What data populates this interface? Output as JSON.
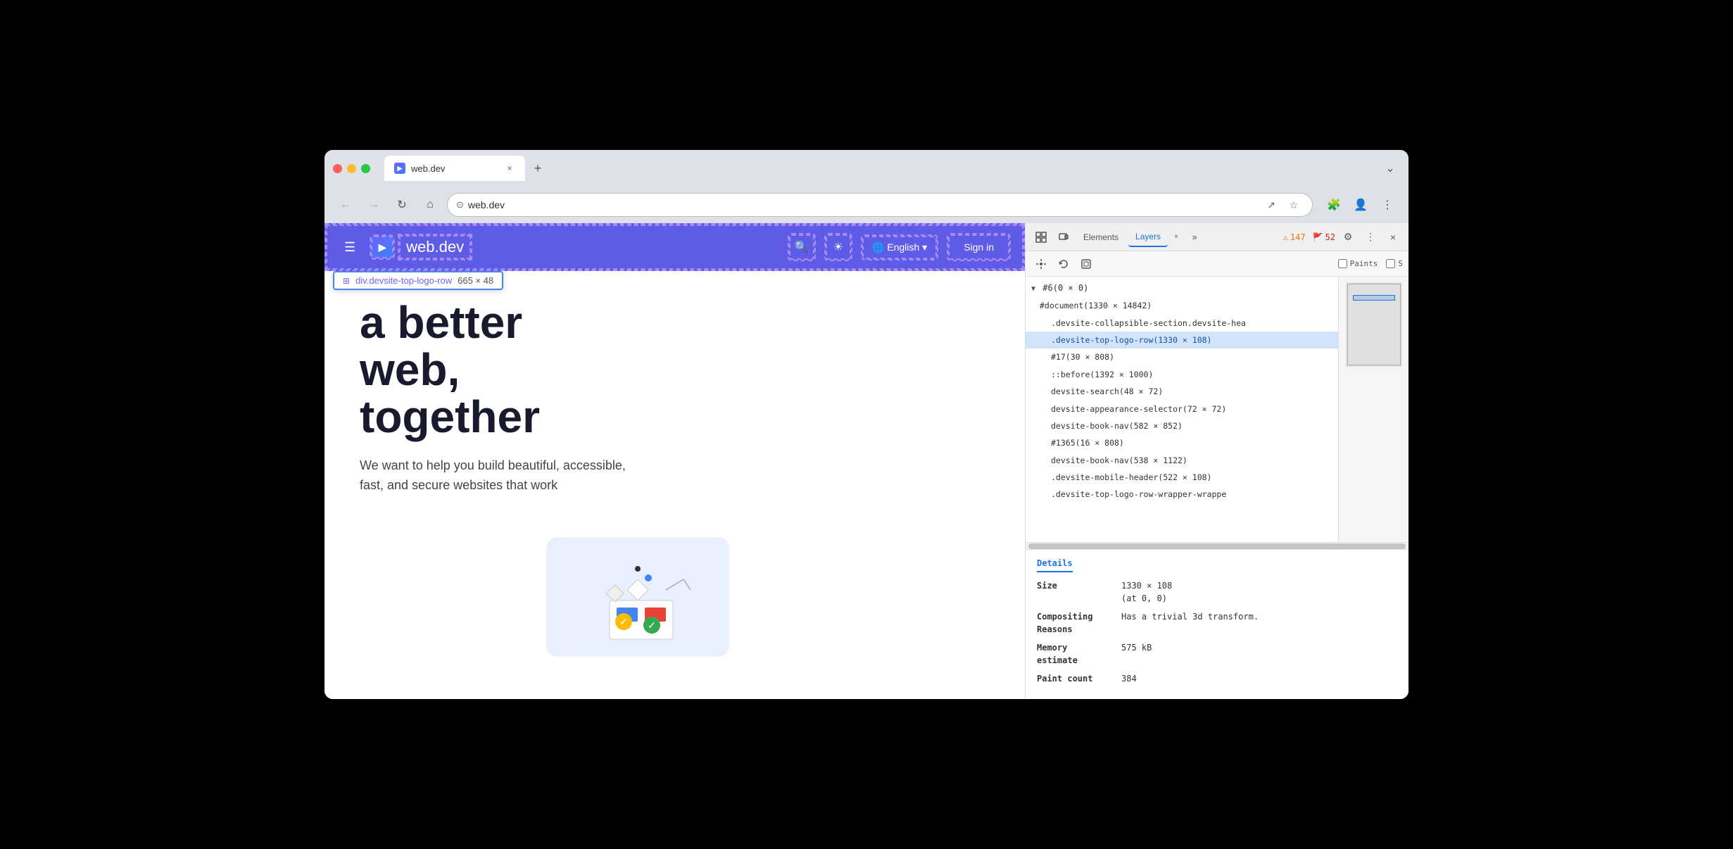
{
  "browser": {
    "tab_title": "web.dev",
    "tab_favicon": "▶",
    "url": "web.dev",
    "close_label": "×",
    "new_tab_label": "+",
    "dropdown_label": "⌄"
  },
  "nav": {
    "back_label": "←",
    "forward_label": "→",
    "reload_label": "↻",
    "home_label": "⌂",
    "url_icon": "⊙",
    "share_label": "↗",
    "bookmark_label": "☆",
    "extensions_label": "🧩",
    "profile_label": "👤",
    "more_label": "⋮"
  },
  "site": {
    "menu_icon": "☰",
    "logo_icon": "▶",
    "logo_text": "web.dev",
    "search_icon": "🔍",
    "theme_icon": "☀",
    "globe_icon": "🌐",
    "lang_label": "English",
    "lang_arrow": "▾",
    "signin_label": "Sign in"
  },
  "element_tooltip": {
    "icon": "⊞",
    "name": "div.devsite-top-logo-row",
    "size": "665 × 48"
  },
  "hero": {
    "heading_line1": "a better",
    "heading_line2": "web,",
    "heading_line3": "together",
    "subtext": "We want to help you build beautiful, accessible, fast, and secure websites that work"
  },
  "devtools": {
    "inspect_icon": "⊹",
    "device_icon": "⬚",
    "elements_tab": "Elements",
    "layers_tab": "Layers",
    "layers_tab_close": "×",
    "more_tabs_label": "»",
    "warning_count": "147",
    "error_count": "52",
    "settings_icon": "⚙",
    "more_icon": "⋮",
    "close_icon": "×",
    "warning_icon": "⚠",
    "error_icon": "🚩"
  },
  "layers_toolbar": {
    "pan_icon": "✥",
    "rotate_icon": "↺",
    "reset_icon": "⊡",
    "paints_label": "Paints",
    "slow_label": "S"
  },
  "layers_tree": {
    "items": [
      {
        "label": "#6(0 × 0)",
        "indent": 0,
        "selected": false,
        "arrow": "▼"
      },
      {
        "label": "#document(1330 × 14842)",
        "indent": 1,
        "selected": false,
        "arrow": ""
      },
      {
        "label": ".devsite-collapsible-section.devsite-hea",
        "indent": 2,
        "selected": false,
        "arrow": ""
      },
      {
        "label": ".devsite-top-logo-row(1330 × 108)",
        "indent": 2,
        "selected": true,
        "arrow": ""
      },
      {
        "label": "#17(30 × 808)",
        "indent": 2,
        "selected": false,
        "arrow": ""
      },
      {
        "label": "::before(1392 × 1000)",
        "indent": 2,
        "selected": false,
        "arrow": ""
      },
      {
        "label": "devsite-search(48 × 72)",
        "indent": 2,
        "selected": false,
        "arrow": ""
      },
      {
        "label": "devsite-appearance-selector(72 × 72)",
        "indent": 2,
        "selected": false,
        "arrow": ""
      },
      {
        "label": "devsite-book-nav(582 × 852)",
        "indent": 2,
        "selected": false,
        "arrow": ""
      },
      {
        "label": "#1365(16 × 808)",
        "indent": 2,
        "selected": false,
        "arrow": ""
      },
      {
        "label": "devsite-book-nav(538 × 1122)",
        "indent": 2,
        "selected": false,
        "arrow": ""
      },
      {
        "label": ".devsite-mobile-header(522 × 108)",
        "indent": 2,
        "selected": false,
        "arrow": ""
      },
      {
        "label": ".devsite-top-logo-row-wrapper-wrappe",
        "indent": 2,
        "selected": false,
        "arrow": ""
      }
    ]
  },
  "details": {
    "header": "Details",
    "size_label": "Size",
    "size_value": "1330 × 108",
    "size_at": "(at 0, 0)",
    "compositing_label": "Compositing\nReasons",
    "compositing_value": "Has a trivial 3d transform.",
    "memory_label": "Memory\nestimate",
    "memory_value": "575 kB",
    "paint_count_label": "Paint count",
    "paint_count_value": "384"
  }
}
